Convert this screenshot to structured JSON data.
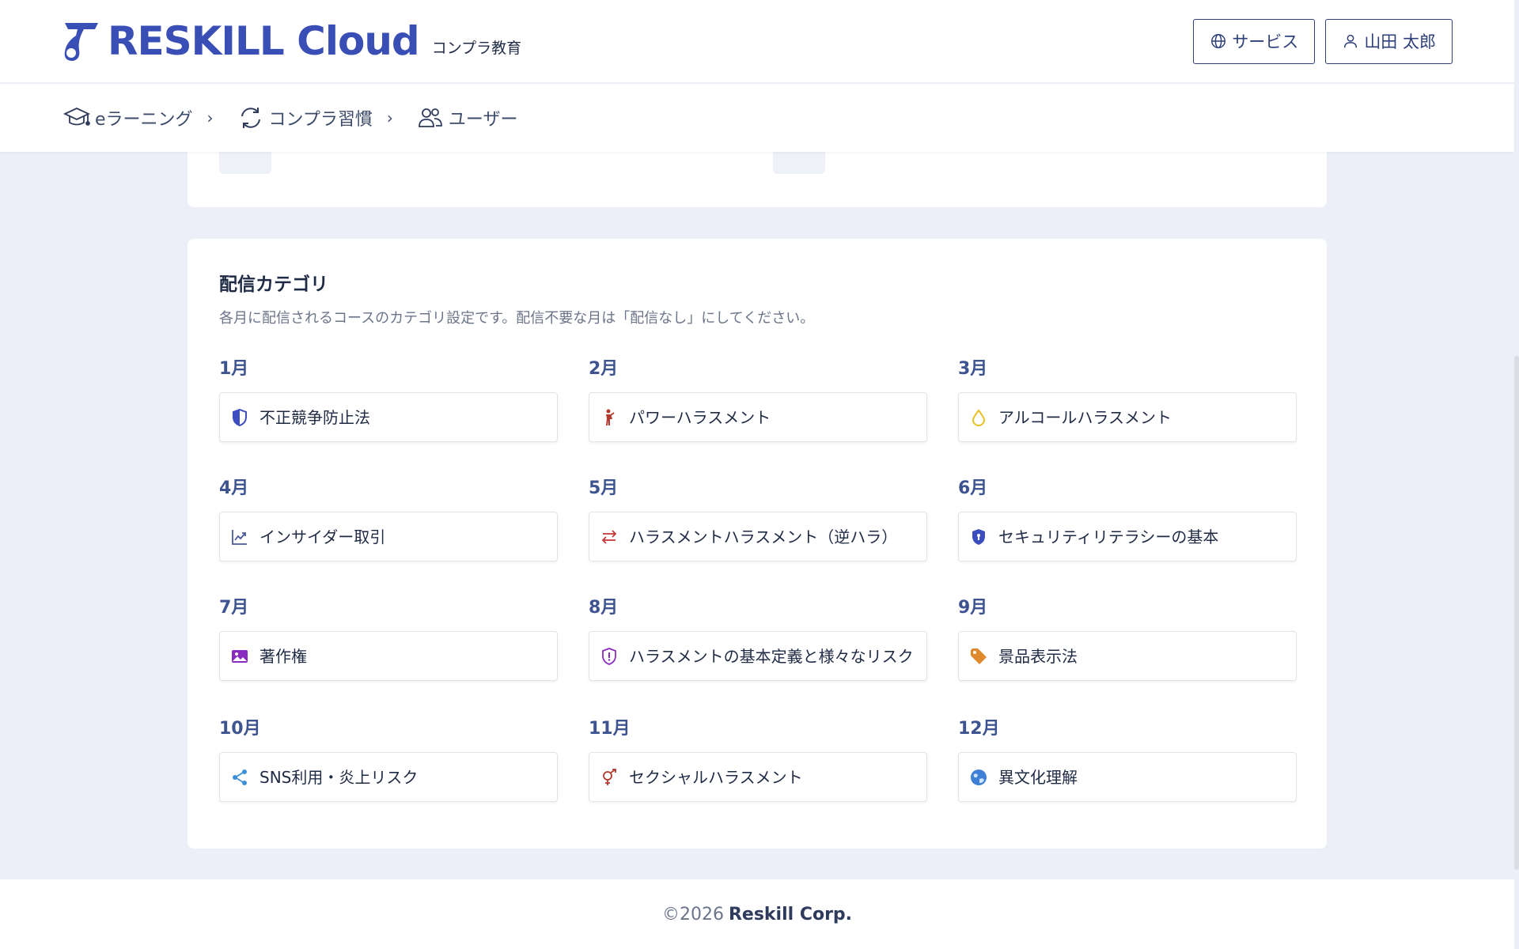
{
  "header": {
    "logo_text": "RESKILL Cloud",
    "product_name": "コンプラ教育",
    "services_button": "サービス",
    "user_button": "山田 太郎"
  },
  "nav": {
    "items": [
      {
        "label": "eラーニング",
        "icon": "graduation-cap-icon",
        "chevron": true
      },
      {
        "label": "コンプラ習慣",
        "icon": "refresh-icon",
        "chevron": true
      },
      {
        "label": "ユーザー",
        "icon": "users-icon",
        "chevron": false
      }
    ]
  },
  "delivery": {
    "title": "配信カテゴリ",
    "description": "各月に配信されるコースのカテゴリ設定です。配信不要な月は「配信なし」にしてください。",
    "months": [
      {
        "month": "1月",
        "category": "不正競争防止法",
        "icon": "shield-icon",
        "color": "#3b4dbf"
      },
      {
        "month": "2月",
        "category": "パワーハラスメント",
        "icon": "person-icon",
        "color": "#b23a2e"
      },
      {
        "month": "3月",
        "category": "アルコールハラスメント",
        "icon": "drop-icon",
        "color": "#e8c020"
      },
      {
        "month": "4月",
        "category": "インサイダー取引",
        "icon": "trend-chart-icon",
        "color": "#4a5b9a"
      },
      {
        "month": "5月",
        "category": "ハラスメントハラスメント（逆ハラ）",
        "icon": "swap-arrows-icon",
        "color": "#c43a3a"
      },
      {
        "month": "6月",
        "category": "セキュリティリテラシーの基本",
        "icon": "security-shield-icon",
        "color": "#3b4dbf"
      },
      {
        "month": "7月",
        "category": "著作権",
        "icon": "image-icon",
        "color": "#8a2bbf"
      },
      {
        "month": "8月",
        "category": "ハラスメントの基本定義と様々なリスク",
        "icon": "alert-shield-icon",
        "color": "#8a2bbf"
      },
      {
        "month": "9月",
        "category": "景品表示法",
        "icon": "tag-icon",
        "color": "#e08a2e"
      },
      {
        "month": "10月",
        "category": "SNS利用・炎上リスク",
        "icon": "share-icon",
        "color": "#3f8fd6"
      },
      {
        "month": "11月",
        "category": "セクシャルハラスメント",
        "icon": "gender-icon",
        "color": "#b23a2e"
      },
      {
        "month": "12月",
        "category": "異文化理解",
        "icon": "globe-icon",
        "color": "#3f7fd6"
      }
    ]
  },
  "footer": {
    "copyright": "©2026",
    "company": "Reskill Corp."
  }
}
